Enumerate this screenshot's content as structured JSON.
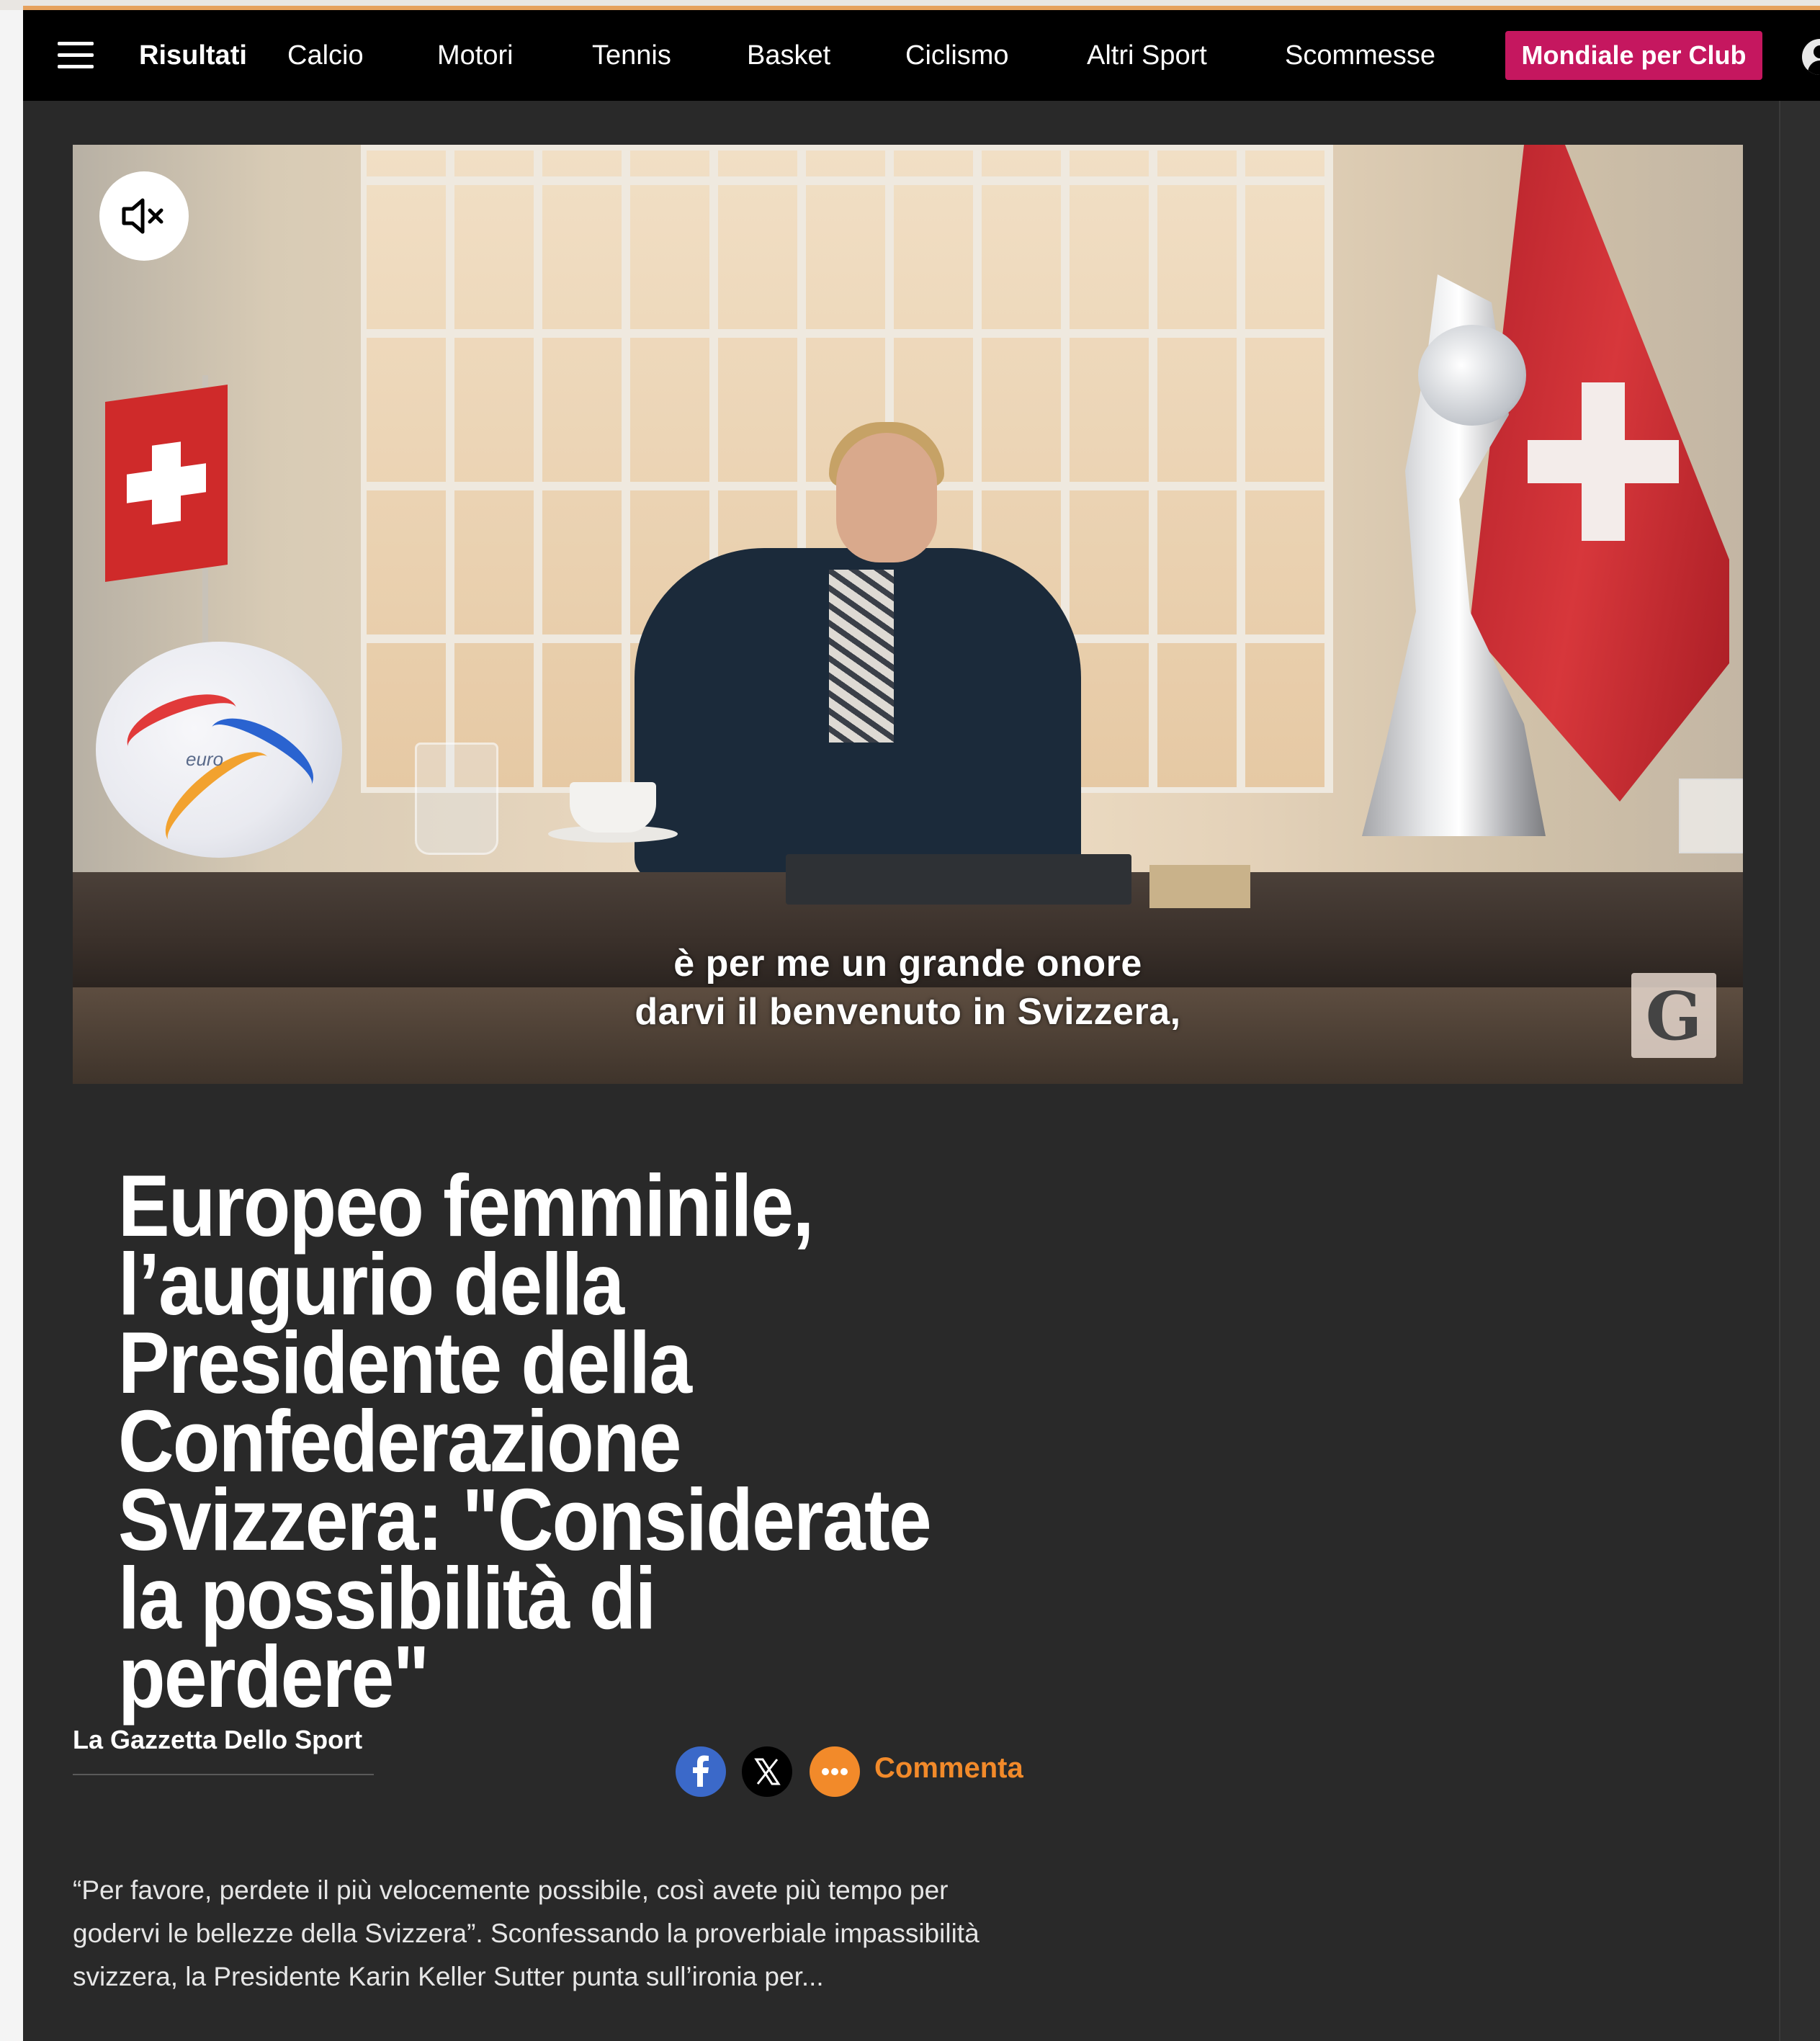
{
  "nav": {
    "items": [
      "Risultati",
      "Calcio",
      "Motori",
      "Tennis",
      "Basket",
      "Ciclismo",
      "Altri Sport",
      "Scommesse"
    ],
    "cta_label": "Mondiale per Club"
  },
  "video": {
    "subtitle_line1": "è per me un grande onore",
    "subtitle_line2": "darvi il benvenuto in Svizzera,",
    "watermark": "G",
    "ball_text": "euro",
    "muted": true
  },
  "article": {
    "headline": "Europeo femminile, l’augurio della Presidente della Confederazione Svizzera: \"Considerate la possibilità di perdere\"",
    "source": "La Gazzetta Dello Sport",
    "comment_label": "Commenta",
    "lead": "“Per favore, perdete il più velocemente possibile, così avete più tempo per godervi le bellezze della Svizzera”. Sconfessando la proverbiale impassibilità svizzera, la Presidente Karin Keller Sutter punta sull’ironia per..."
  },
  "icons": {
    "menu": "hamburger-icon",
    "user": "user-icon",
    "mute": "volume-mute-icon",
    "share_facebook": "facebook-icon",
    "share_x": "x-icon",
    "share_more": "more-icon"
  },
  "colors": {
    "nav_bg": "#000000",
    "page_bg": "#292929",
    "cta": "#c5175f",
    "accent_orange": "#f28a2a",
    "facebook": "#3b69c9"
  }
}
